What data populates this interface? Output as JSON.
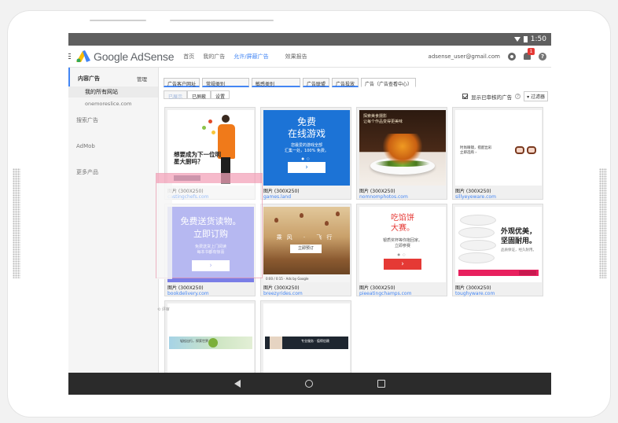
{
  "status": {
    "time": "1:50"
  },
  "app": {
    "name": "Google AdSense",
    "user_email": "adsense_user@gmail.com",
    "notification_count": "1"
  },
  "nav": [
    "首页",
    "我的广告",
    "允许/屏蔽广告",
    "效果报告"
  ],
  "sidebar": {
    "section": "内容广告",
    "manage": "管理",
    "all_sites": "我的所有网站",
    "site": "onemoreslice.com",
    "items": [
      "搜索广告",
      "AdMob",
      "更多产品"
    ]
  },
  "tabs": [
    "广告客户网址",
    "常规类别",
    "敏感类别",
    "广告联盟",
    "广告投放",
    "广告（广告查看中心）"
  ],
  "subtabs": [
    "已展示",
    "已屏蔽",
    "设置"
  ],
  "filters": {
    "show_reviewed": "显示已审核的广告",
    "help": "?",
    "filter": "▾ 过滤器"
  },
  "ads": [
    {
      "type": "图片 (300X250)",
      "domain": "castingchefs.com",
      "headline": "想要成为下一位明星大厨吗？"
    },
    {
      "type": "图片 (300X250)",
      "domain": "games.land",
      "headline1": "免费",
      "headline2": "在线游戏",
      "sub1": "您最爱的游戏全部",
      "sub2": "汇集一处，100% 免费。",
      "btn": "›",
      "dots": "●○"
    },
    {
      "type": "图片 (300X250)",
      "domain": "nomnomphotos.com",
      "title1": "探索美食摄影",
      "title2": "让每个作品变得更美味"
    },
    {
      "type": "图片 (300X250)",
      "domain": "sillyeyeware.com",
      "text1": "时尚眼镜，搭配出彩",
      "text2": "立即选购 ›"
    },
    {
      "type": "图片 (300X250)",
      "domain": "bookdelivery.com",
      "headline1": "免费送货读物。",
      "headline2": "立即订购",
      "sub1": "免费送货上门阅读",
      "sub2": "每本书都有惊喜",
      "btn": "›"
    },
    {
      "type": "图片 (300X250)",
      "domain": "breezyrides.com",
      "headline": "乘风 · 飞行",
      "btn": "立即预订",
      "controls": "0:00 / 0:15 · Ads by Google"
    },
    {
      "type": "图片 (300X250)",
      "domain": "pieeatingchamps.com",
      "headline1": "吃馅饼",
      "headline2": "大赛。",
      "sub1": "银质奖杯等你抱回家。",
      "sub2": "立即参赛",
      "dots": "●○",
      "btn": "›"
    },
    {
      "type": "图片 (300X250)",
      "domain": "toughyware.com",
      "headline1": "外观优美，",
      "headline2": "坚固耐用。",
      "sub": "品质保证，经久耐用。"
    },
    {
      "type": "",
      "domain": "",
      "strip_text": "轻松出行，探索世界"
    },
    {
      "type": "",
      "domain": "",
      "strip_text": "专业服务 · 值得信赖"
    }
  ],
  "overlay": {
    "caption": "已屏蔽",
    "handle": "⟲ 评审"
  },
  "colors": {
    "accent": "#4285f4",
    "ad_blue": "#1c73d6",
    "ad_red": "#e53935",
    "ad_pink": "#e8205e"
  }
}
